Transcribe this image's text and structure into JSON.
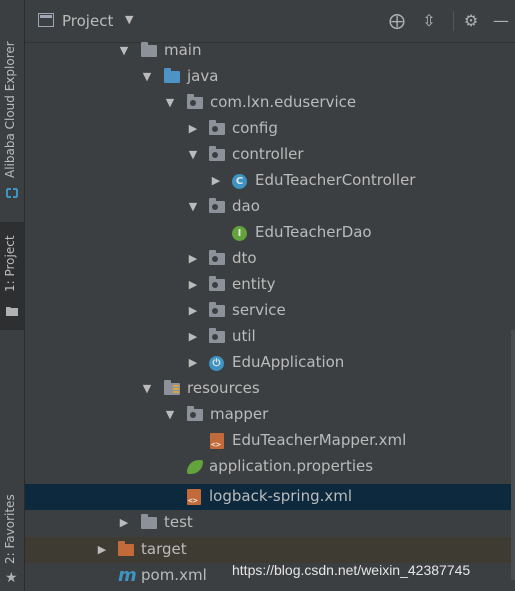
{
  "side_strip": {
    "tabs": [
      {
        "label": "Alibaba Cloud Explorer",
        "icon": "alibaba-cloud-icon"
      },
      {
        "label": "1: Project",
        "icon": "folder-icon"
      },
      {
        "label": "2: Favorites",
        "icon": "star-icon"
      }
    ]
  },
  "header": {
    "title": "Project",
    "dropdown_icon": "caret-down-icon",
    "buttons": [
      {
        "name": "locate-icon",
        "glyph": "⨁"
      },
      {
        "name": "collapse-all-icon",
        "glyph": "⇳"
      },
      {
        "name": "settings-gear-icon",
        "glyph": "⚙"
      },
      {
        "name": "hide-panel-icon",
        "glyph": "—"
      }
    ]
  },
  "tree": {
    "items": [
      {
        "label": "main",
        "expanded": true,
        "icon": "folder-icon"
      },
      {
        "label": "java",
        "expanded": true,
        "icon": "source-folder-icon"
      },
      {
        "label": "com.lxn.eduservice",
        "expanded": true,
        "icon": "package-icon"
      },
      {
        "label": "config",
        "expanded": false,
        "icon": "package-icon"
      },
      {
        "label": "controller",
        "expanded": true,
        "icon": "package-icon"
      },
      {
        "label": "EduTeacherController",
        "expanded": false,
        "icon": "class-icon",
        "badge": "C"
      },
      {
        "label": "dao",
        "expanded": true,
        "icon": "package-icon"
      },
      {
        "label": "EduTeacherDao",
        "icon": "interface-icon",
        "badge": "I"
      },
      {
        "label": "dto",
        "expanded": false,
        "icon": "package-icon"
      },
      {
        "label": "entity",
        "expanded": false,
        "icon": "package-icon"
      },
      {
        "label": "service",
        "expanded": false,
        "icon": "package-icon"
      },
      {
        "label": "util",
        "expanded": false,
        "icon": "package-icon"
      },
      {
        "label": "EduApplication",
        "expanded": false,
        "icon": "spring-app-icon"
      },
      {
        "label": "resources",
        "expanded": true,
        "icon": "resources-folder-icon"
      },
      {
        "label": "mapper",
        "expanded": true,
        "icon": "package-icon"
      },
      {
        "label": "EduTeacherMapper.xml",
        "icon": "xml-file-icon"
      },
      {
        "label": "application.properties",
        "icon": "spring-properties-icon"
      },
      {
        "label": "logback-spring.xml",
        "icon": "xml-file-icon",
        "selected": true
      },
      {
        "label": "test",
        "expanded": false,
        "icon": "folder-icon"
      },
      {
        "label": "target",
        "expanded": false,
        "icon": "excluded-folder-icon"
      },
      {
        "label": "pom.xml",
        "icon": "maven-icon",
        "badge": "m"
      }
    ]
  },
  "watermark": "https://blog.csdn.net/weixin_42387745",
  "colors": {
    "panel_bg": "#3c3f41",
    "selection": "#0d293e",
    "text": "#bbbbbb",
    "accent_blue": "#3d94c2",
    "excluded_orange": "#c26a3a"
  }
}
